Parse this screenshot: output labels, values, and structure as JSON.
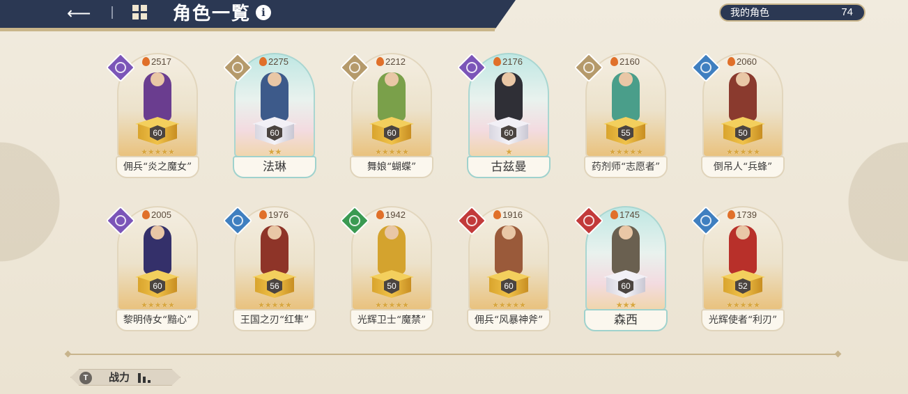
{
  "header": {
    "title": "角色一覧",
    "back_icon": "back-arrow-icon",
    "menu_icon": "grid-menu-icon",
    "info_icon": "i"
  },
  "my_characters": {
    "label": "我的角色",
    "count": "74"
  },
  "characters": [
    {
      "name": "佣兵“炎之魔女”",
      "power": "2517",
      "level": "60",
      "stars": 5,
      "class": "magic",
      "class_color": "#7b55b8",
      "frame": "normal",
      "sprite_color": "#6a3d8f"
    },
    {
      "name": "法琳",
      "power": "2275",
      "level": "60",
      "stars": 2,
      "class": "light",
      "class_color": "#b59a6b",
      "frame": "teal",
      "sprite_color": "#3d5a8a"
    },
    {
      "name": "舞娘“蝴蝶”",
      "power": "2212",
      "level": "60",
      "stars": 5,
      "class": "light",
      "class_color": "#b59a6b",
      "frame": "normal",
      "sprite_color": "#7aa04a"
    },
    {
      "name": "古兹曼",
      "power": "2176",
      "level": "60",
      "stars": 1,
      "class": "magic",
      "class_color": "#7b55b8",
      "frame": "teal",
      "sprite_color": "#2f2f36"
    },
    {
      "name": "药剂师“志愿者”",
      "power": "2160",
      "level": "55",
      "stars": 5,
      "class": "light",
      "class_color": "#b59a6b",
      "frame": "normal",
      "sprite_color": "#4a9e8a"
    },
    {
      "name": "倒吊人“兵蜂”",
      "power": "2060",
      "level": "50",
      "stars": 5,
      "class": "wind",
      "class_color": "#3f7fc0",
      "frame": "normal",
      "sprite_color": "#8a3a2e"
    },
    {
      "name": "黎明侍女“黯心”",
      "power": "2005",
      "level": "60",
      "stars": 5,
      "class": "magic",
      "class_color": "#7b55b8",
      "frame": "normal",
      "sprite_color": "#34306a"
    },
    {
      "name": "王国之刃“红隼”",
      "power": "1976",
      "level": "56",
      "stars": 5,
      "class": "wind",
      "class_color": "#3f7fc0",
      "frame": "normal",
      "sprite_color": "#8e3428"
    },
    {
      "name": "光辉卫士“魔禁”",
      "power": "1942",
      "level": "50",
      "stars": 5,
      "class": "guard",
      "class_color": "#3a9a52",
      "frame": "normal",
      "sprite_color": "#d4a32e"
    },
    {
      "name": "佣兵“风暴神斧”",
      "power": "1916",
      "level": "60",
      "stars": 5,
      "class": "blade",
      "class_color": "#c23a3a",
      "frame": "normal",
      "sprite_color": "#9a5a3a"
    },
    {
      "name": "森西",
      "power": "1745",
      "level": "60",
      "stars": 3,
      "class": "blade",
      "class_color": "#c23a3a",
      "frame": "teal",
      "sprite_color": "#6a6050"
    },
    {
      "name": "光辉使者“利刃”",
      "power": "1739",
      "level": "52",
      "stars": 5,
      "class": "wind",
      "class_color": "#3f7fc0",
      "frame": "normal",
      "sprite_color": "#b8302a"
    }
  ],
  "sort": {
    "label": "战力",
    "icon": "filter-icon"
  }
}
